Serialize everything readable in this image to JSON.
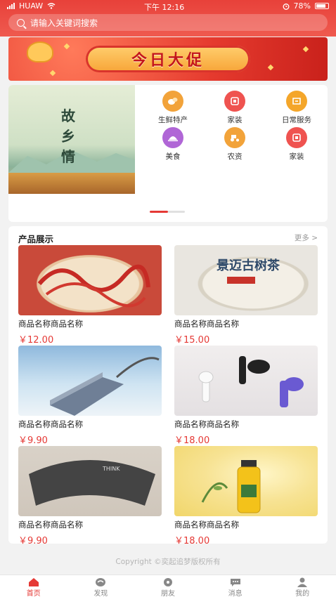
{
  "status_bar": {
    "carrier": "HUAW",
    "time": "下午 12:16",
    "battery": "78%"
  },
  "search": {
    "placeholder": "请输入关键词搜索"
  },
  "banner": {
    "title": "今日大促"
  },
  "poster": {
    "title": "故乡情"
  },
  "categories": [
    {
      "label": "生鲜特产",
      "icon": "fresh-food-icon",
      "color": "#f2a33a"
    },
    {
      "label": "家装",
      "icon": "home-decor-icon",
      "color": "#ef5350"
    },
    {
      "label": "日常服务",
      "icon": "daily-service-icon",
      "color": "#f4a62a"
    },
    {
      "label": "美食",
      "icon": "cuisine-icon",
      "color": "#b066d6"
    },
    {
      "label": "农资",
      "icon": "tractor-icon",
      "color": "#f2a33a"
    },
    {
      "label": "家装",
      "icon": "home-decor-icon",
      "color": "#ef5350"
    }
  ],
  "carousel": {
    "active_index": 0,
    "count": 2
  },
  "products_section": {
    "title": "产品展示",
    "more_label": "更多 >",
    "items": [
      {
        "name": "商品名称商品名称",
        "price": "￥12.00",
        "image": "mooncake-gift-box"
      },
      {
        "name": "商品名称商品名称",
        "price": "￥15.00",
        "image": "pu-erh-tea-cake"
      },
      {
        "name": "商品名称商品名称",
        "price": "￥9.90",
        "image": "usb-hub"
      },
      {
        "name": "商品名称商品名称",
        "price": "￥18.00",
        "image": "wireless-earbuds"
      },
      {
        "name": "商品名称商品名称",
        "price": "￥9.90",
        "image": "neck-massager"
      },
      {
        "name": "商品名称商品名称",
        "price": "￥18.00",
        "image": "olive-oil-bottle"
      }
    ]
  },
  "footer": {
    "copyright": "Copyright ©奕起追梦版权所有"
  },
  "tabbar": [
    {
      "label": "首页",
      "icon": "home-icon",
      "active": true
    },
    {
      "label": "发现",
      "icon": "discover-icon",
      "active": false
    },
    {
      "label": "朋友",
      "icon": "friends-icon",
      "active": false
    },
    {
      "label": "消息",
      "icon": "message-icon",
      "active": false
    },
    {
      "label": "我的",
      "icon": "profile-icon",
      "active": false
    }
  ],
  "colors": {
    "brand": "#e8413a",
    "price": "#e53935"
  }
}
